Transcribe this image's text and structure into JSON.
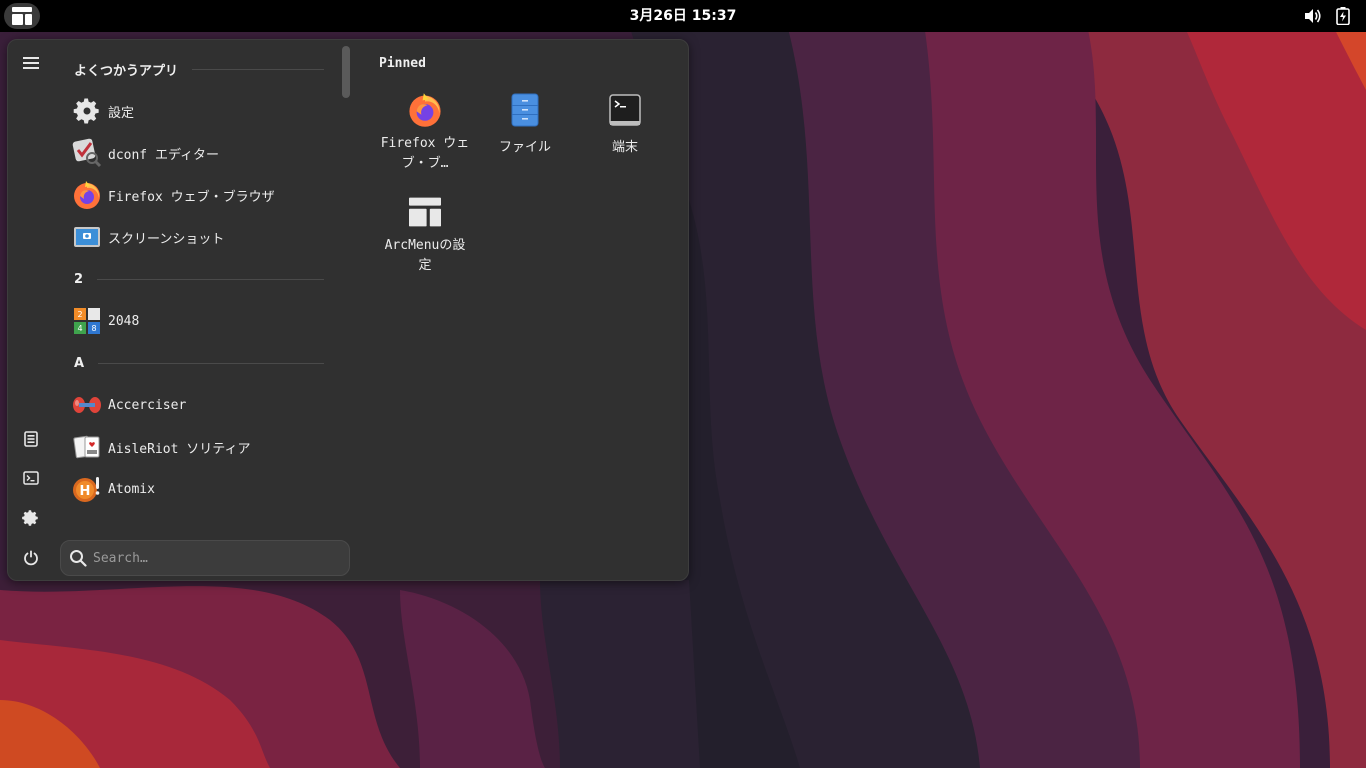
{
  "topbar": {
    "clock": "3月26日  15:37",
    "activities_icon": "arcmenu-layout-icon",
    "tray_icons": [
      "volume-icon",
      "battery-icon"
    ]
  },
  "sidebar": {
    "buttons": [
      "hamburger-menu-icon",
      "document-icon",
      "terminal-icon",
      "gear-icon",
      "power-icon"
    ]
  },
  "applist": {
    "sections": [
      {
        "header": "よくつかうアプリ",
        "apps": [
          {
            "label": "設定",
            "icon": "settings-gear-icon"
          },
          {
            "label": "dconf エディター",
            "icon": "dconf-editor-icon"
          },
          {
            "label": "Firefox ウェブ・ブラウザ",
            "icon": "firefox-icon"
          },
          {
            "label": "スクリーンショット",
            "icon": "screenshot-icon"
          }
        ]
      },
      {
        "header": "2",
        "apps": [
          {
            "label": "2048",
            "icon": "game-2048-icon"
          }
        ]
      },
      {
        "header": "A",
        "apps": [
          {
            "label": "Accerciser",
            "icon": "accerciser-icon"
          },
          {
            "label": "AisleRiot ソリティア",
            "icon": "aisleriot-icon"
          },
          {
            "label": "Atomix",
            "icon": "atomix-icon"
          }
        ]
      }
    ]
  },
  "search": {
    "placeholder": "Search…",
    "value": ""
  },
  "pinned": {
    "title": "Pinned",
    "items": [
      {
        "label": "Firefox ウェブ・ブ…",
        "icon": "firefox-icon"
      },
      {
        "label": "ファイル",
        "icon": "files-icon"
      },
      {
        "label": "端末",
        "icon": "terminal-icon"
      },
      {
        "label": "ArcMenuの設定",
        "icon": "arcmenu-settings-icon"
      }
    ]
  },
  "colors": {
    "topbar": "#000000",
    "menu_bg": "#303030",
    "wallpaper_red": "#a8283a",
    "wallpaper_purple": "#4a2240",
    "wallpaper_dark": "#231f2c"
  }
}
